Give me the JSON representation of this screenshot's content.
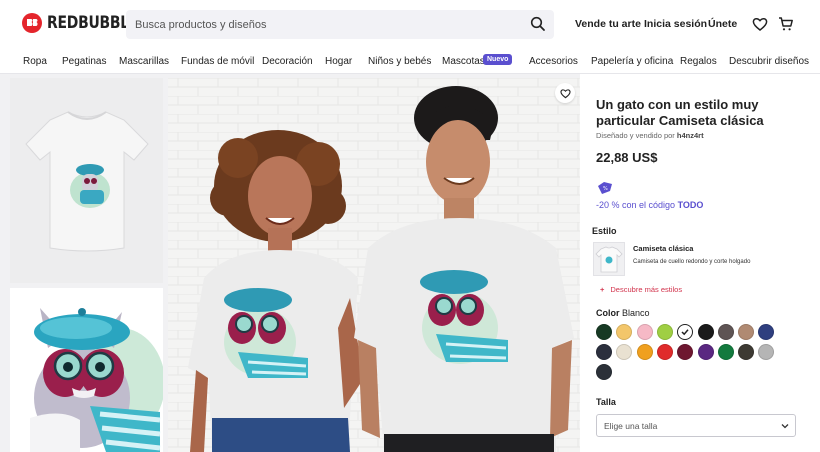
{
  "header": {
    "logo_text": "REDBUBBLE",
    "search_placeholder": "Busca productos y diseños",
    "links": [
      "Vende tu arte",
      "Inicia sesión",
      "Únete"
    ]
  },
  "nav": {
    "items": [
      "Ropa",
      "Pegatinas",
      "Mascarillas",
      "Fundas de móvil",
      "Decoración",
      "Hogar",
      "Niños y bebés",
      "Mascotas",
      "Accesorios",
      "Papelería y oficina",
      "Regalos",
      "Descubrir diseños"
    ],
    "badge": "Nuevo"
  },
  "product": {
    "title": "Un gato con un estilo muy particular Camiseta clásica",
    "seller_prefix": "Diseñado y vendido por",
    "seller_name": "h4nz4rt",
    "price": "22,88 US$",
    "promo_prefix": "-20 % con el código",
    "promo_code": "TODO",
    "style_label": "Estilo",
    "style_name": "Camiseta clásica",
    "style_desc": "Camiseta de cuello redondo y corte holgado",
    "more_styles": "Descubre más estilos",
    "color_label": "Color",
    "color_value": "Blanco",
    "size_label": "Talla",
    "size_placeholder": "Elige una talla"
  },
  "colors": {
    "swatches": [
      "#173a24",
      "#f3c66a",
      "#f6b9c6",
      "#9fcf43",
      "#ffffff",
      "#1a1a1a",
      "#5e5454",
      "#b08a72",
      "#2f3f7f",
      "#2b2f3d",
      "#e9e1d1",
      "#f0a01e",
      "#e02b2b",
      "#6e1730",
      "#5a2781",
      "#137a3e",
      "#3d3a33",
      "#b5b5b5",
      "#2b3038"
    ],
    "selected_index": 4,
    "accent": "#5a4fcf",
    "brand_red": "#e4252c"
  },
  "icons": [
    "search-icon",
    "heart-icon",
    "cart-icon",
    "chevron-down-icon",
    "tag-icon",
    "plus-icon"
  ]
}
